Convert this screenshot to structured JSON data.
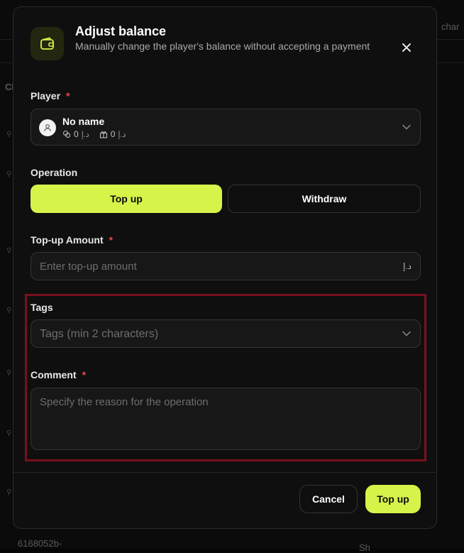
{
  "modal": {
    "title": "Adjust balance",
    "subtitle": "Manually change the player's balance without accepting a payment",
    "close_icon": "close-icon"
  },
  "player": {
    "label": "Player",
    "required_mark": "*",
    "name": "No name",
    "balance_value": "0",
    "bonus_value": "0",
    "currency": "د.إ"
  },
  "operation": {
    "label": "Operation",
    "options": [
      "Top up",
      "Withdraw"
    ],
    "selected": "Top up"
  },
  "amount": {
    "label": "Top-up Amount",
    "required_mark": "*",
    "placeholder": "Enter top-up amount",
    "currency": "د.إ"
  },
  "tags": {
    "label": "Tags",
    "placeholder": "Tags (min 2 characters)"
  },
  "comment": {
    "label": "Comment",
    "required_mark": "*",
    "placeholder": "Specify the reason for the operation"
  },
  "footer": {
    "cancel_label": "Cancel",
    "submit_label": "Top up"
  },
  "background": {
    "fragment_top_right": "char",
    "fragment_left": "Cl",
    "fragment_bottom": "6168052b-",
    "fragment_bottom_right": "Sh"
  },
  "colors": {
    "accent": "#d6f34a",
    "highlight_border": "#7a0f1f",
    "required": "#e5484d"
  }
}
